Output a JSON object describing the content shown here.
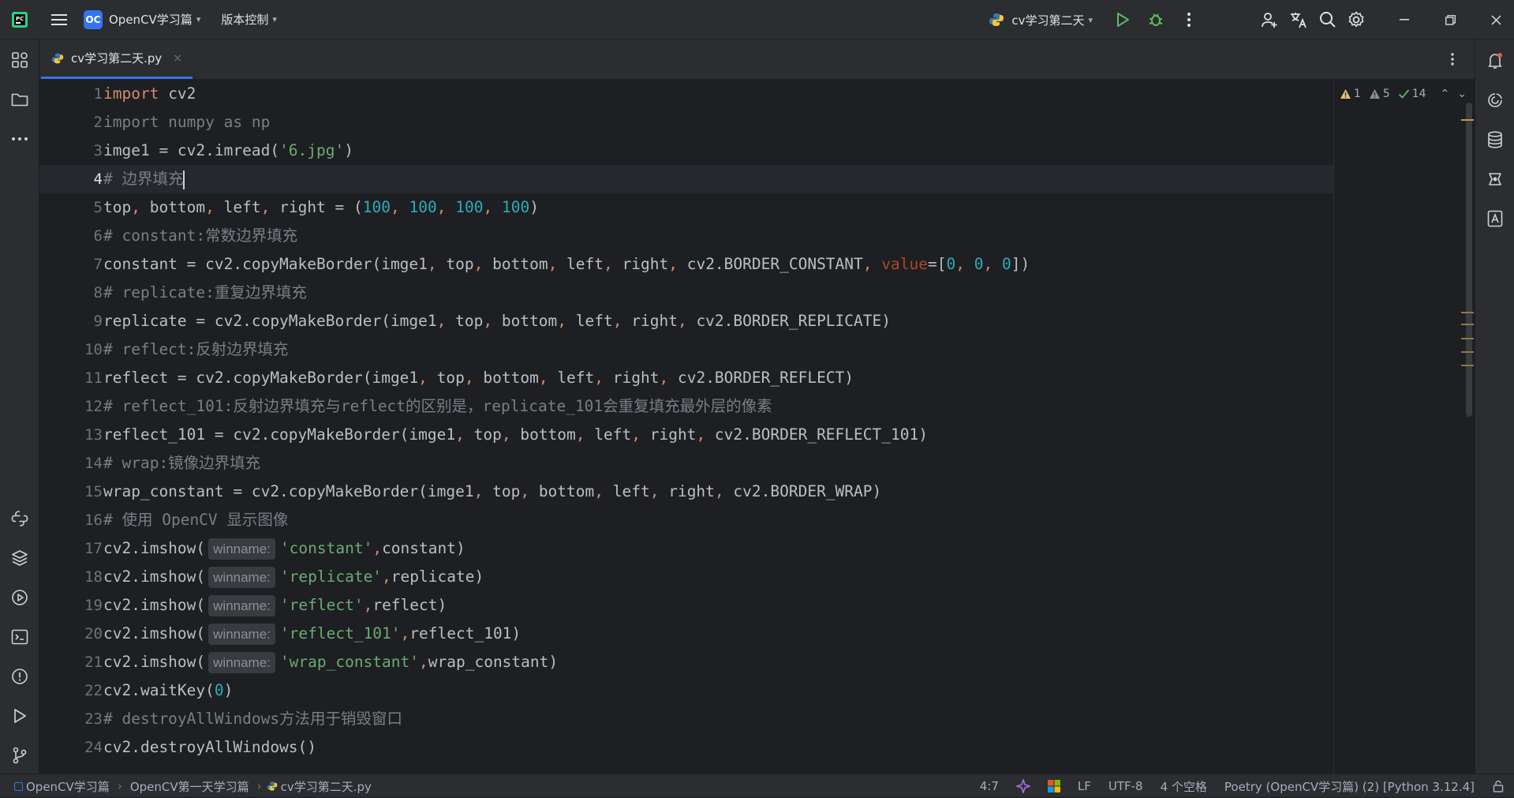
{
  "titlebar": {
    "project_badge": "OC",
    "project_name": "OpenCV学习篇",
    "vcs_menu": "版本控制",
    "run_config": "cv学习第二天"
  },
  "tab": {
    "filename": "cv学习第二天.py",
    "close": "×"
  },
  "inspections": {
    "errors": "1",
    "warnings": "5",
    "ok": "14"
  },
  "code": {
    "current_line": 4,
    "line_numbers": [
      "1",
      "2",
      "3",
      "4",
      "5",
      "6",
      "7",
      "8",
      "9",
      "10",
      "11",
      "12",
      "13",
      "14",
      "15",
      "16",
      "17",
      "18",
      "19",
      "20",
      "21",
      "22",
      "23",
      "24"
    ],
    "l1": {
      "kw": "import",
      "rest": " cv2"
    },
    "l2": {
      "text": "import numpy as np"
    },
    "l3": {
      "a": "imge1 = cv2.imread(",
      "s": "'6.jpg'",
      "b": ")"
    },
    "l4": {
      "text": "# 边界填充"
    },
    "l5": {
      "a": "top",
      "b": " bottom",
      "c": " left",
      "d": " right = (",
      "n1": "100",
      "n2": "100",
      "n3": "100",
      "n4": "100",
      "e": ")"
    },
    "l6": {
      "text": "# constant:常数边界填充"
    },
    "l7": {
      "a": "constant = cv2.copyMakeBorder(imge1",
      "b": " top",
      "c": " bottom",
      "d": " left",
      "e": " right",
      "f": " cv2.BORDER_CONSTANT",
      "p": "value",
      "g": "=[",
      "n1": "0",
      "n2": "0",
      "n3": "0",
      "h": "])"
    },
    "l8": {
      "text": "# replicate:重复边界填充"
    },
    "l9": {
      "a": "replicate = cv2.copyMakeBorder(imge1",
      "b": " top",
      "c": " bottom",
      "d": " left",
      "e": " right",
      "f": " cv2.BORDER_REPLICATE)"
    },
    "l10": {
      "text": "# reflect:反射边界填充"
    },
    "l11": {
      "a": "reflect = cv2.copyMakeBorder(imge1",
      "b": " top",
      "c": " bottom",
      "d": " left",
      "e": " right",
      "f": " cv2.BORDER_REFLECT)"
    },
    "l12": {
      "text": "# reflect_101:反射边界填充与reflect的区别是，replicate_101会重复填充最外层的像素"
    },
    "l13": {
      "a": "reflect_101 = cv2.copyMakeBorder(imge1",
      "b": " top",
      "c": " bottom",
      "d": " left",
      "e": " right",
      "f": " cv2.BORDER_REFLECT_101)"
    },
    "l14": {
      "text": "# wrap:镜像边界填充"
    },
    "l15": {
      "a": "wrap_constant = cv2.copyMakeBorder(imge1",
      "b": " top",
      "c": " bottom",
      "d": " left",
      "e": " right",
      "f": " cv2.BORDER_WRAP)"
    },
    "l16": {
      "text": "# 使用 OpenCV 显示图像"
    },
    "l17": {
      "a": "cv2.imshow(",
      "hint": "winname:",
      "s": "'constant'",
      "b": "constant)"
    },
    "l18": {
      "a": "cv2.imshow(",
      "hint": "winname:",
      "s": "'replicate'",
      "b": "replicate)"
    },
    "l19": {
      "a": "cv2.imshow(",
      "hint": "winname:",
      "s": "'reflect'",
      "b": "reflect)"
    },
    "l20": {
      "a": "cv2.imshow(",
      "hint": "winname:",
      "s": "'reflect_101'",
      "b": "reflect_101)"
    },
    "l21": {
      "a": "cv2.imshow(",
      "hint": "winname:",
      "s": "'wrap_constant'",
      "b": "wrap_constant)"
    },
    "l22": {
      "a": "cv2.waitKey(",
      "n": "0",
      "b": ")"
    },
    "l23": {
      "text": "# destroyAllWindows方法用于销毁窗口"
    },
    "l24": {
      "text": "cv2.destroyAllWindows()"
    },
    "comma": ","
  },
  "statusbar": {
    "crumbs": [
      "OpenCV学习篇",
      "OpenCV第一天学习篇",
      "cv学习第二天.py"
    ],
    "position": "4:7",
    "line_sep": "LF",
    "encoding": "UTF-8",
    "indent": "4 个空格",
    "interpreter": "Poetry (OpenCV学习篇) (2) [Python 3.12.4]"
  },
  "colors": {
    "accent": "#3574f0",
    "keyword": "#cf8e6d",
    "number": "#2aacb8",
    "string": "#6aab73",
    "comment": "#7a7e85",
    "warning": "#e5c07b"
  }
}
